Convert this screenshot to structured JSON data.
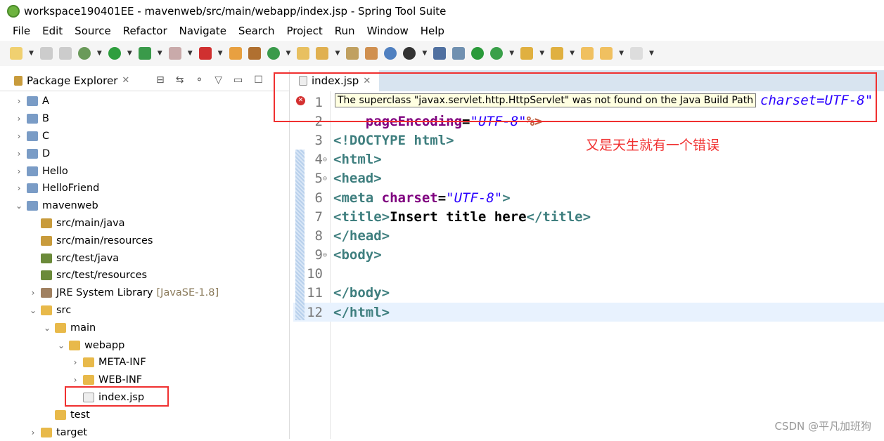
{
  "window": {
    "title": "workspace190401EE - mavenweb/src/main/webapp/index.jsp - Spring Tool Suite"
  },
  "menu": [
    "File",
    "Edit",
    "Source",
    "Refactor",
    "Navigate",
    "Search",
    "Project",
    "Run",
    "Window",
    "Help"
  ],
  "package_explorer": {
    "title": "Package Explorer",
    "tree": [
      {
        "label": "A",
        "depth": 0,
        "chev": ">",
        "icon": "proj"
      },
      {
        "label": "B",
        "depth": 0,
        "chev": ">",
        "icon": "proj"
      },
      {
        "label": "C",
        "depth": 0,
        "chev": ">",
        "icon": "proj"
      },
      {
        "label": "D",
        "depth": 0,
        "chev": ">",
        "icon": "proj"
      },
      {
        "label": "Hello",
        "depth": 0,
        "chev": ">",
        "icon": "proj"
      },
      {
        "label": "HelloFriend",
        "depth": 0,
        "chev": ">",
        "icon": "proj"
      },
      {
        "label": "mavenweb",
        "depth": 0,
        "chev": "v",
        "icon": "proj"
      },
      {
        "label": "src/main/java",
        "depth": 1,
        "chev": "",
        "icon": "pkg"
      },
      {
        "label": "src/main/resources",
        "depth": 1,
        "chev": "",
        "icon": "pkg"
      },
      {
        "label": "src/test/java",
        "depth": 1,
        "chev": "",
        "icon": "jar"
      },
      {
        "label": "src/test/resources",
        "depth": 1,
        "chev": "",
        "icon": "jar"
      },
      {
        "label": "JRE System Library",
        "hint": "[JavaSE-1.8]",
        "depth": 1,
        "chev": ">",
        "icon": "lib"
      },
      {
        "label": "src",
        "depth": 1,
        "chev": "v",
        "icon": "fold"
      },
      {
        "label": "main",
        "depth": 2,
        "chev": "v",
        "icon": "fold"
      },
      {
        "label": "webapp",
        "depth": 3,
        "chev": "v",
        "icon": "fold"
      },
      {
        "label": "META-INF",
        "depth": 4,
        "chev": ">",
        "icon": "fold"
      },
      {
        "label": "WEB-INF",
        "depth": 4,
        "chev": ">",
        "icon": "fold"
      },
      {
        "label": "index.jsp",
        "depth": 4,
        "chev": "",
        "icon": "jsp"
      },
      {
        "label": "test",
        "depth": 2,
        "chev": "",
        "icon": "fold"
      },
      {
        "label": "target",
        "depth": 1,
        "chev": ">",
        "icon": "fold"
      }
    ]
  },
  "editor": {
    "tab": "index.jsp",
    "lines": [
      {
        "n": "1",
        "fold": "",
        "tokens": []
      },
      {
        "n": "2",
        "fold": "",
        "tokens": [
          [
            "t-txt",
            "    "
          ],
          [
            "t-attr",
            "pageEncoding"
          ],
          [
            "t-txt",
            "="
          ],
          [
            "t-str",
            "\"UTF-8\""
          ],
          [
            "t-dir",
            "%>"
          ]
        ]
      },
      {
        "n": "3",
        "fold": "",
        "tokens": [
          [
            "t-tag",
            "<!DOCTYPE html>"
          ]
        ]
      },
      {
        "n": "4",
        "fold": "⊖",
        "tokens": [
          [
            "t-tag",
            "<html>"
          ]
        ]
      },
      {
        "n": "5",
        "fold": "⊖",
        "tokens": [
          [
            "t-tag",
            "<head>"
          ]
        ]
      },
      {
        "n": "6",
        "fold": "",
        "tokens": [
          [
            "t-tag",
            "<meta "
          ],
          [
            "t-attr",
            "charset"
          ],
          [
            "t-txt",
            "="
          ],
          [
            "t-str",
            "\"UTF-8\""
          ],
          [
            "t-tag",
            ">"
          ]
        ]
      },
      {
        "n": "7",
        "fold": "",
        "tokens": [
          [
            "t-tag",
            "<title>"
          ],
          [
            "t-txt",
            "Insert title here"
          ],
          [
            "t-tag",
            "</title>"
          ]
        ]
      },
      {
        "n": "8",
        "fold": "",
        "tokens": [
          [
            "t-tag",
            "</head>"
          ]
        ]
      },
      {
        "n": "9",
        "fold": "⊖",
        "tokens": [
          [
            "t-tag",
            "<body>"
          ]
        ]
      },
      {
        "n": "10",
        "fold": "",
        "tokens": []
      },
      {
        "n": "11",
        "fold": "",
        "tokens": [
          [
            "t-tag",
            "</body>"
          ]
        ]
      },
      {
        "n": "12",
        "fold": "",
        "tokens": [
          [
            "t-tag",
            "</html>"
          ]
        ]
      }
    ],
    "line1_visible_tail": "charset=UTF-8\"",
    "tooltip": "The superclass \"javax.servlet.http.HttpServlet\" was not found on the Java Build Path"
  },
  "annotation": "又是天生就有一个错误",
  "watermark": "CSDN @平凡加班狗",
  "colors": {
    "annotation_red": "#f03030",
    "tag": "#3f7f7f",
    "attr": "#7f007f",
    "string": "#2a00ff"
  }
}
